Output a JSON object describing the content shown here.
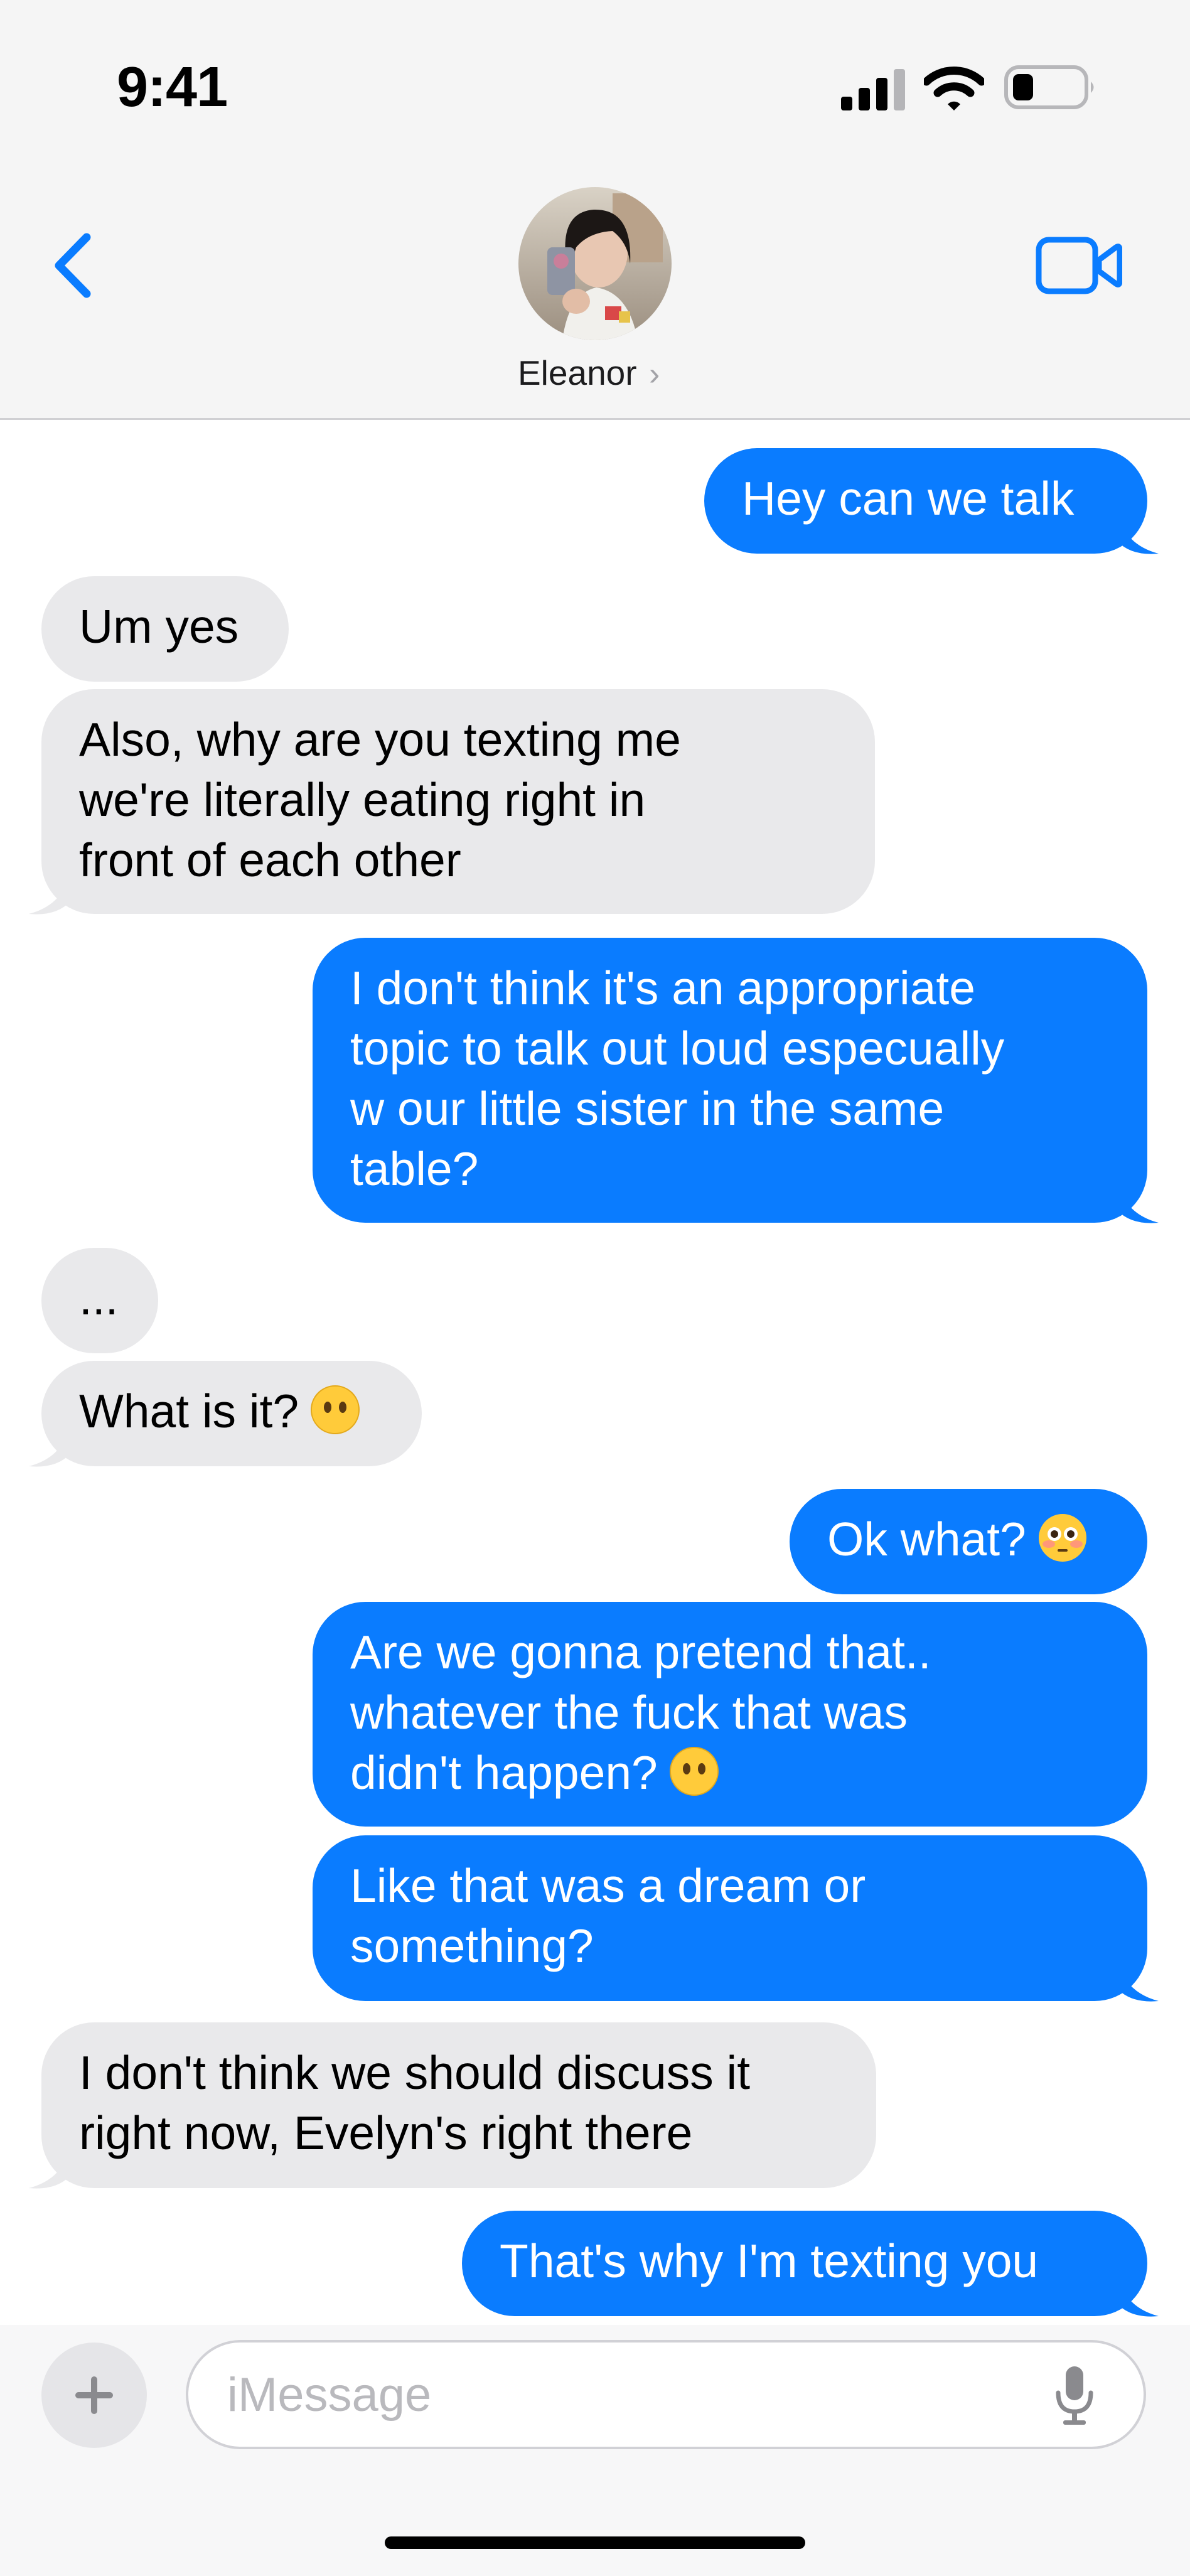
{
  "status_bar": {
    "time": "9:41"
  },
  "header": {
    "contact_name": "Eleanor",
    "chevron": "›",
    "back_icon": "chevron-left-icon",
    "video_icon": "video-camera-icon"
  },
  "messages": [
    {
      "from": "me",
      "text": "Hey can we talk"
    },
    {
      "from": "them",
      "text": "Um yes"
    },
    {
      "from": "them",
      "lines": [
        "Also, why are you texting me",
        "we're literally eating right in",
        "front of each other"
      ]
    },
    {
      "from": "me",
      "lines": [
        "I don't think it's an appropriate",
        "topic to talk out loud especually",
        "w our little sister in the same",
        "table?"
      ]
    },
    {
      "from": "them",
      "text": "..."
    },
    {
      "from": "them",
      "text": "What is it?",
      "emoji": "no-mouth-face"
    },
    {
      "from": "me",
      "text": "Ok what?",
      "emoji": "flushed-face"
    },
    {
      "from": "me",
      "lines": [
        "Are we gonna pretend that..",
        "whatever the fuck that was",
        "didn't happen?"
      ],
      "emoji": "no-mouth-face"
    },
    {
      "from": "me",
      "lines": [
        "Like that was a dream or",
        "something?"
      ]
    },
    {
      "from": "them",
      "lines": [
        "I don't think we should discuss it",
        "right now, Evelyn's right there"
      ]
    },
    {
      "from": "me",
      "text": "That's why I'm texting you"
    }
  ],
  "composer": {
    "placeholder": "iMessage",
    "plus_icon": "plus-icon",
    "mic_icon": "microphone-icon"
  },
  "colors": {
    "sent_bubble": "#0a7cff",
    "received_bubble": "#e9e9eb",
    "accent": "#0a7cff"
  }
}
